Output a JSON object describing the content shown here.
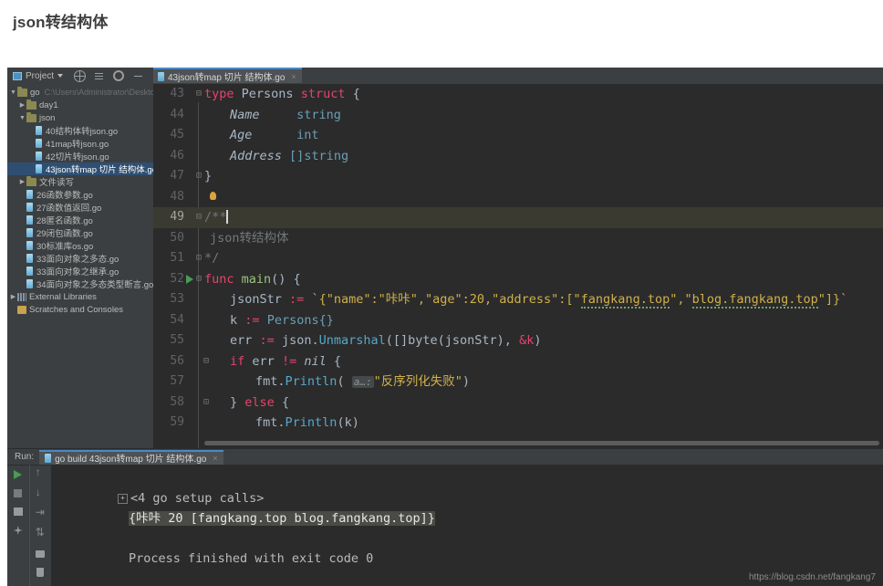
{
  "page_title": "json转结构体",
  "toolbar": {
    "project_label": "Project",
    "icons": [
      "locate-target-icon",
      "collapse-all-icon",
      "gear-icon",
      "minimize-icon"
    ]
  },
  "editor_tab": {
    "label": "43json转map 切片 结构体.go",
    "close": "×"
  },
  "tree": [
    {
      "arrow": "▼",
      "icon": "folder-icon",
      "label": "go",
      "hint": "C:\\Users\\Administrator\\Deskto",
      "indent": 0,
      "selected": false
    },
    {
      "arrow": "▶",
      "icon": "folder-icon",
      "label": "day1",
      "hint": "",
      "indent": 1,
      "selected": false
    },
    {
      "arrow": "▼",
      "icon": "folder-icon",
      "label": "json",
      "hint": "",
      "indent": 1,
      "selected": false
    },
    {
      "arrow": "",
      "icon": "go-file-icon",
      "label": "40结构体转json.go",
      "hint": "",
      "indent": 2,
      "selected": false
    },
    {
      "arrow": "",
      "icon": "go-file-icon",
      "label": "41map转json.go",
      "hint": "",
      "indent": 2,
      "selected": false
    },
    {
      "arrow": "",
      "icon": "go-file-icon",
      "label": "42切片转json.go",
      "hint": "",
      "indent": 2,
      "selected": false
    },
    {
      "arrow": "",
      "icon": "go-file-icon",
      "label": "43json转map 切片 结构体.go",
      "hint": "",
      "indent": 2,
      "selected": true
    },
    {
      "arrow": "▶",
      "icon": "folder-icon",
      "label": "文件读写",
      "hint": "",
      "indent": 1,
      "selected": false
    },
    {
      "arrow": "",
      "icon": "go-file-icon",
      "label": "26函数参数.go",
      "hint": "",
      "indent": 1,
      "selected": false
    },
    {
      "arrow": "",
      "icon": "go-file-icon",
      "label": "27函数值返回.go",
      "hint": "",
      "indent": 1,
      "selected": false
    },
    {
      "arrow": "",
      "icon": "go-file-icon",
      "label": "28匿名函数.go",
      "hint": "",
      "indent": 1,
      "selected": false
    },
    {
      "arrow": "",
      "icon": "go-file-icon",
      "label": "29闭包函数.go",
      "hint": "",
      "indent": 1,
      "selected": false
    },
    {
      "arrow": "",
      "icon": "go-file-icon",
      "label": "30标准库os.go",
      "hint": "",
      "indent": 1,
      "selected": false
    },
    {
      "arrow": "",
      "icon": "go-file-icon",
      "label": "33面向对象之多态.go",
      "hint": "",
      "indent": 1,
      "selected": false
    },
    {
      "arrow": "",
      "icon": "go-file-icon",
      "label": "33面向对象之继承.go",
      "hint": "",
      "indent": 1,
      "selected": false
    },
    {
      "arrow": "",
      "icon": "go-file-icon",
      "label": "34面向对象之多态类型断言.go",
      "hint": "",
      "indent": 1,
      "selected": false
    },
    {
      "arrow": "▶",
      "icon": "libraries-icon",
      "label": "External Libraries",
      "hint": "",
      "indent": 0,
      "selected": false
    },
    {
      "arrow": "",
      "icon": "scratches-icon",
      "label": "Scratches and Consoles",
      "hint": "",
      "indent": 0,
      "selected": false
    }
  ],
  "code": {
    "lines": [
      {
        "num": "43",
        "fold": "⊟",
        "current": false,
        "run": false,
        "bulb": false
      },
      {
        "num": "44",
        "fold": "",
        "current": false,
        "run": false,
        "bulb": false
      },
      {
        "num": "45",
        "fold": "",
        "current": false,
        "run": false,
        "bulb": false
      },
      {
        "num": "46",
        "fold": "",
        "current": false,
        "run": false,
        "bulb": false
      },
      {
        "num": "47",
        "fold": "⊡",
        "current": false,
        "run": false,
        "bulb": false
      },
      {
        "num": "48",
        "fold": "",
        "current": false,
        "run": false,
        "bulb": true
      },
      {
        "num": "49",
        "fold": "⊟",
        "current": true,
        "run": false,
        "bulb": false
      },
      {
        "num": "50",
        "fold": "",
        "current": false,
        "run": false,
        "bulb": false
      },
      {
        "num": "51",
        "fold": "⊡",
        "current": false,
        "run": false,
        "bulb": false
      },
      {
        "num": "52",
        "fold": "⊟",
        "current": false,
        "run": true,
        "bulb": false
      },
      {
        "num": "53",
        "fold": "",
        "current": false,
        "run": false,
        "bulb": false
      },
      {
        "num": "54",
        "fold": "",
        "current": false,
        "run": false,
        "bulb": false
      },
      {
        "num": "55",
        "fold": "",
        "current": false,
        "run": false,
        "bulb": false
      },
      {
        "num": "56",
        "fold": "⊟",
        "current": false,
        "run": false,
        "bulb": false
      },
      {
        "num": "57",
        "fold": "",
        "current": false,
        "run": false,
        "bulb": false
      },
      {
        "num": "58",
        "fold": "⊡",
        "current": false,
        "run": false,
        "bulb": false
      },
      {
        "num": "59",
        "fold": "",
        "current": false,
        "run": false,
        "bulb": false
      }
    ],
    "text": {
      "l43": "type Persons struct {",
      "l44": "Name     string",
      "l45": "Age      int",
      "l46": "Address  []string",
      "l47": "}",
      "l49": "/**",
      "l50": "json转结构体",
      "l51": "*/",
      "l52": "func main() {",
      "l53": "jsonStr := `{\"name\":\"咔咔\",\"age\":20,\"address\":[\"fangkang.top\",\"blog.fangkang.top\"]}`",
      "l54": "k := Persons{}",
      "l55": "err := json.Unmarshal([]byte(jsonStr), &k)",
      "l56": "if err != nil {",
      "l57": "fmt.Println( a…: \"反序列化失败\")",
      "l58": "} else {",
      "l59": "fmt.Println(k)"
    },
    "tokens": {
      "kw_type": "type",
      "name_persons": "Persons",
      "kw_struct": "struct",
      "brace_open": "{",
      "f_name": "Name",
      "t_string": "string",
      "f_age": "Age",
      "t_int": "int",
      "f_address": "Address",
      "t_slice_string": "[]string",
      "brace_close": "}",
      "cmt_open": "/**",
      "cmt_body": "json转结构体",
      "cmt_close": "*/",
      "kw_func": "func",
      "fn_main": "main",
      "parens": "() {",
      "var_jsonstr": "jsonStr",
      "assign": ":=",
      "json_literal_pre": "`{\"name\":\"咔咔\",\"age\":20,\"address\":[\"",
      "json_url1": "fangkang.top",
      "json_mid": "\",\"",
      "json_url2": "blog.fangkang.top",
      "json_literal_post": "\"]}`",
      "var_k": "k",
      "persons_init": "Persons{}",
      "var_err": "err",
      "pkg_json": "json",
      "dot": ".",
      "fn_unmarshal": "Unmarshal",
      "byte_cast": "([]byte(jsonStr), ",
      "amp_k": "&k",
      "close_paren": ")",
      "kw_if": "if",
      "neq": "!=",
      "kw_nil": "nil",
      "pkg_fmt": "fmt",
      "fn_println": "Println",
      "param_hint": "a…:",
      "str_fail": "\"反序列化失败\"",
      "kw_else": "else",
      "arg_k": "(k)"
    }
  },
  "run_panel": {
    "label": "Run:",
    "tab_label": "go build 43json转map 切片 结构体.go",
    "tab_close": "×",
    "side_icons_left": [
      "run-icon",
      "stop-icon",
      "rows-icon",
      "pin-icon"
    ],
    "side_icons_right": [
      "scroll-up-icon",
      "scroll-down-icon",
      "soft-wrap-icon",
      "sort-icon",
      "print-icon",
      "trash-icon"
    ],
    "output": [
      {
        "text": "<4 go setup calls>",
        "collapsible": true,
        "selected": false
      },
      {
        "text": "{咔咔 20 [fangkang.top blog.fangkang.top]}",
        "collapsible": false,
        "selected": true
      },
      {
        "text": "",
        "collapsible": false,
        "selected": false
      },
      {
        "text": "Process finished with exit code 0",
        "collapsible": false,
        "selected": false
      }
    ]
  },
  "watermark": "https://blog.csdn.net/fangkang7",
  "colors": {
    "ide_bg": "#3c3f41",
    "editor_bg": "#2b2b2b",
    "accent_tab": "#4a88c7",
    "selection": "#2f4f72",
    "keyword": "#cc7832",
    "string": "#d1b14a",
    "comment": "#72787a",
    "function": "#98c379",
    "builtin": "#6a9fb5",
    "current_line": "#3a3a30"
  }
}
